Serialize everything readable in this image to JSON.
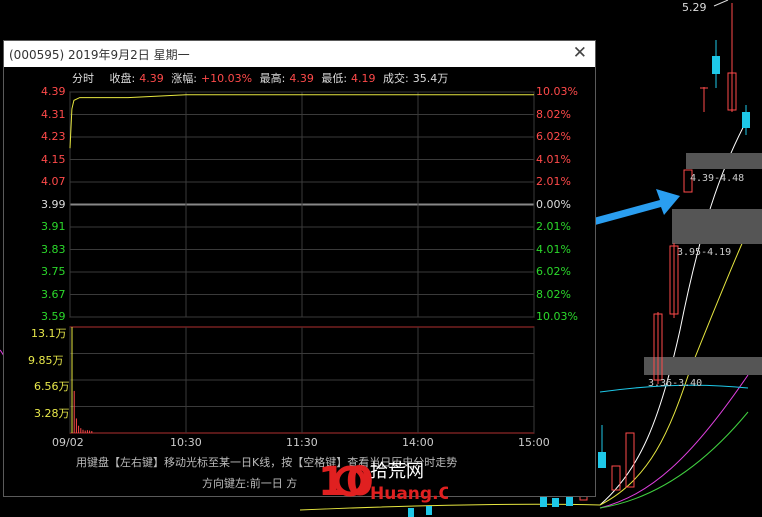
{
  "window": {
    "title": "(000595) 2019年9月2日 星期一",
    "close_icon": "close-icon"
  },
  "info_bar": {
    "tab_label": "分时",
    "close_label": "收盘:",
    "close_value": "4.39",
    "change_label": "涨幅:",
    "change_value": "+10.03%",
    "high_label": "最高:",
    "high_value": "4.39",
    "low_label": "最低:",
    "low_value": "4.19",
    "volume_label": "成交:",
    "volume_value": "35.4万"
  },
  "price_axis_left": [
    "4.39",
    "4.31",
    "4.23",
    "4.15",
    "4.07",
    "3.99",
    "3.91",
    "3.83",
    "3.75",
    "3.67",
    "3.59"
  ],
  "price_axis_right": [
    "10.03%",
    "8.02%",
    "6.02%",
    "4.01%",
    "2.01%",
    "0.00%",
    "2.01%",
    "4.01%",
    "6.02%",
    "8.02%",
    "10.03%"
  ],
  "volume_axis": [
    "13.1万",
    "9.85万",
    "6.56万",
    "3.28万"
  ],
  "time_axis": [
    "09/02",
    "10:30",
    "11:30",
    "14:00",
    "15:00"
  ],
  "hints": {
    "line1": "用键盘【左右键】移动光标至某一日K线，按【空格键】查看当日历史分时走势",
    "line2": "方向键左:前一日    方"
  },
  "background_chart": {
    "high_label": "5.29",
    "zone1_label": "4.39-4.48",
    "zone2_label": "3.95-4.19",
    "zone3_label": "3.36-3.40"
  },
  "watermark": {
    "number": "10",
    "brand_cn": "拾荒网",
    "brand_en": "Huang.CN"
  },
  "colors": {
    "up": "#ff4a4a",
    "down": "#2bd82b",
    "price_line": "#e6e640",
    "arrow": "#2a9ef0",
    "candle_cyan": "#1ec8e8"
  },
  "chart_data": {
    "type": "line",
    "title": "",
    "x": [
      "09:30",
      "09:31",
      "09:32",
      "09:35",
      "09:40",
      "10:00",
      "10:30",
      "11:30",
      "13:00",
      "14:00",
      "15:00"
    ],
    "series": [
      {
        "values": [
          4.19,
          4.33,
          4.36,
          4.37,
          4.37,
          4.37,
          4.38,
          4.38,
          4.38,
          4.38,
          4.38
        ]
      }
    ],
    "ylim": [
      3.59,
      4.39
    ],
    "pre_close": 3.99,
    "volume_ylim": [
      0,
      13.1
    ],
    "volume_unit": "万"
  }
}
